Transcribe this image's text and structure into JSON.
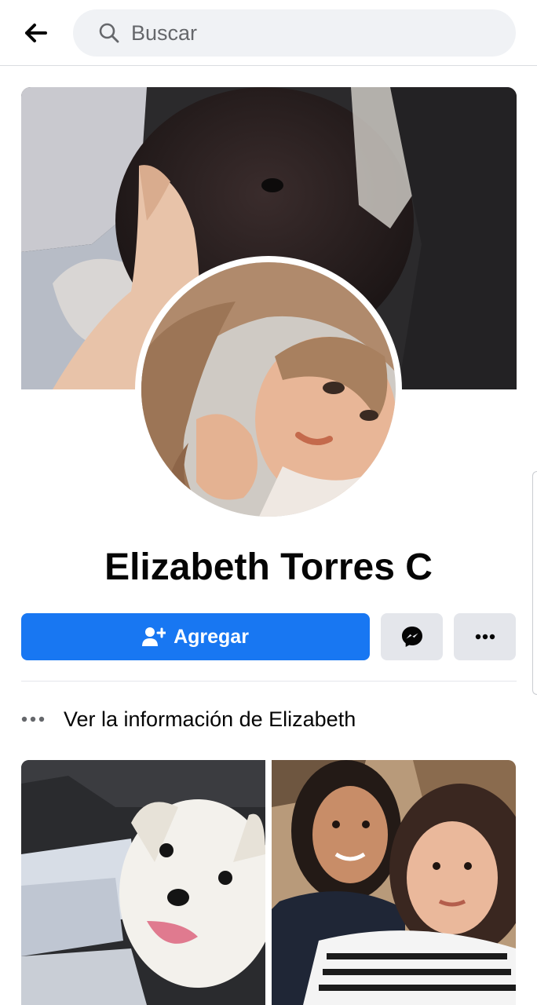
{
  "header": {
    "search_placeholder": "Buscar"
  },
  "profile": {
    "name": "Elizabeth Torres C",
    "add_button_label": "Agregar",
    "info_link_label": "Ver la información de Elizabeth"
  },
  "colors": {
    "accent": "#1877f2",
    "secondary_button_bg": "#e4e6eb",
    "search_bg": "#f0f2f5"
  },
  "icons": {
    "back": "arrow-left-icon",
    "search": "search-icon",
    "add_friend": "person-add-icon",
    "messenger": "messenger-icon",
    "more": "more-horizontal-icon",
    "info": "more-dots-icon"
  }
}
